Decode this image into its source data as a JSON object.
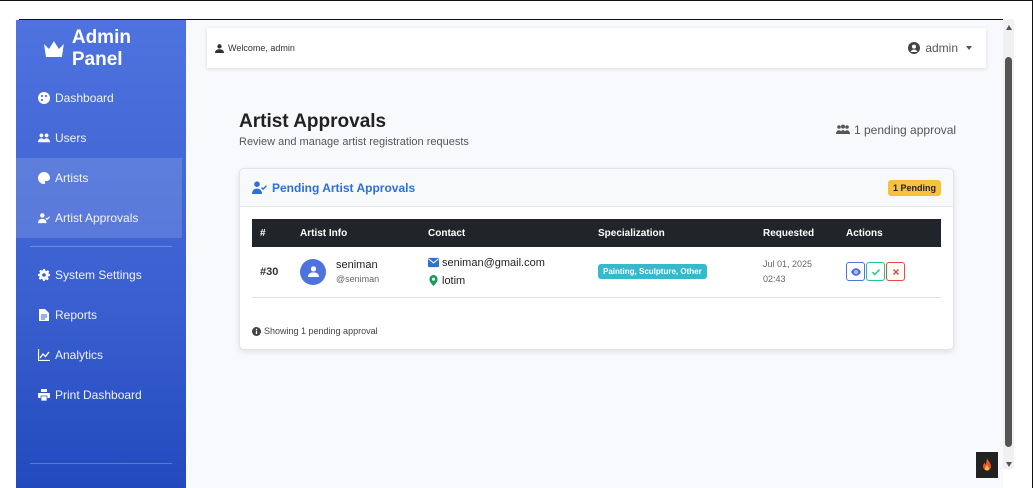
{
  "sidebar": {
    "brand": "Admin Panel",
    "items": [
      {
        "label": "Dashboard",
        "icon": "palette-icon"
      },
      {
        "label": "Users",
        "icon": "users-icon"
      },
      {
        "label": "Artists",
        "icon": "palette-icon"
      },
      {
        "label": "Artist Approvals",
        "icon": "user-check-icon"
      },
      {
        "label": "System Settings",
        "icon": "gear-icon"
      },
      {
        "label": "Reports",
        "icon": "file-icon"
      },
      {
        "label": "Analytics",
        "icon": "chart-line-icon"
      },
      {
        "label": "Print Dashboard",
        "icon": "print-icon"
      }
    ]
  },
  "topbar": {
    "welcome": "Welcome, admin",
    "user": "admin"
  },
  "page": {
    "title": "Artist Approvals",
    "subtitle": "Review and manage artist registration requests",
    "pending_summary": "1 pending approval"
  },
  "card": {
    "title": "Pending Artist Approvals",
    "badge": "1 Pending",
    "columns": [
      "#",
      "Artist Info",
      "Contact",
      "Specialization",
      "Requested",
      "Actions"
    ],
    "rows": [
      {
        "id": "#30",
        "name": "seniman",
        "handle": "@seniman",
        "email": "seniman@gmail.com",
        "location": "lotim",
        "specialization": "Painting, Sculpture, Other",
        "requested_date": "Jul 01, 2025",
        "requested_time": "02:43"
      }
    ],
    "footer": "Showing 1 pending approval"
  },
  "colors": {
    "primary": "#4e73df",
    "success": "#1cc88a",
    "danger": "#e74a3b",
    "warning": "#f6c23e",
    "info": "#36b9cc"
  }
}
